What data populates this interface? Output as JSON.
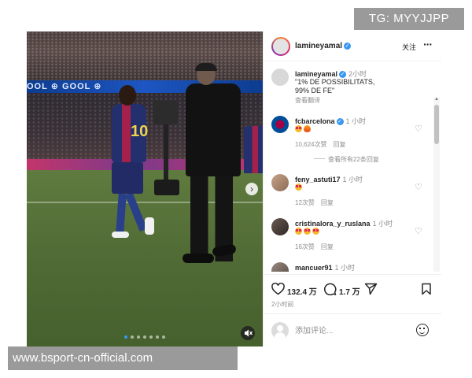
{
  "overlay": {
    "tg_label": "TG: MYYJJPP",
    "website_watermark": "www.bsport-cn-official.com"
  },
  "photo": {
    "stadium_board_text": "OOL  ⊕  GOOL  ⊕",
    "jersey_number": "10",
    "carousel_dots": 7,
    "active_dot": 0
  },
  "header": {
    "username": "lamineyamal",
    "follow_label": "关注",
    "more_label": "···"
  },
  "caption": {
    "username": "lamineyamal",
    "time": "2小时",
    "text_line1": "\"1% DE POSSIBILITATS,",
    "text_line2": "99% DE FE\"",
    "translate_label": "查看翻译"
  },
  "comments": [
    {
      "username": "fcbarcelona",
      "time": "1 小时",
      "likes": "10,624次赞",
      "reply_label": "回复",
      "view_replies": "查看所有22条回复"
    },
    {
      "username": "feny_astuti17",
      "time": "1 小时",
      "likes": "12次赞",
      "reply_label": "回复"
    },
    {
      "username": "cristinalora_y_ruslana",
      "time": "1 小时",
      "likes": "16次赞",
      "reply_label": "回复"
    },
    {
      "username": "mancuer91",
      "time": "1 小时"
    }
  ],
  "actions": {
    "likes_count": "132.4 万",
    "comments_count": "1.7 万",
    "post_time": "2小时前"
  },
  "add_comment": {
    "placeholder": "添加评论..."
  },
  "colors": {
    "verified_blue": "#3897f0",
    "active_dot": "#3897f0",
    "overlay_gray": "#9a9a9a"
  }
}
